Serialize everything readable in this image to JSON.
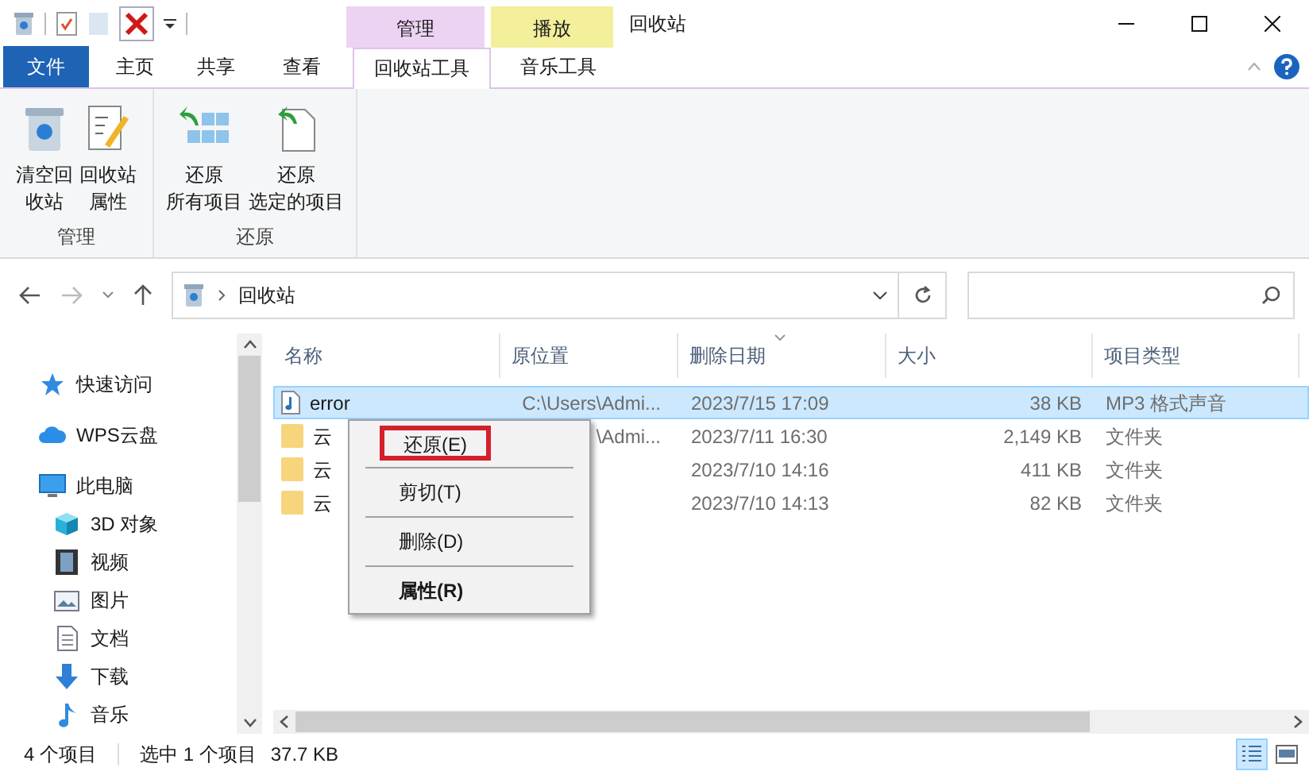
{
  "window": {
    "title": "回收站"
  },
  "context_tab_headers": [
    {
      "label": "管理",
      "color": "#ecd3f3"
    },
    {
      "label": "播放",
      "color": "#f3ef9b"
    }
  ],
  "ribbon_tabs": [
    {
      "label": "文件",
      "kind": "file",
      "selected": false
    },
    {
      "label": "主页",
      "kind": "tab",
      "selected": false
    },
    {
      "label": "共享",
      "kind": "tab",
      "selected": false
    },
    {
      "label": "查看",
      "kind": "tab",
      "selected": false
    },
    {
      "label": "回收站工具",
      "kind": "tab",
      "selected": true
    },
    {
      "label": "音乐工具",
      "kind": "tab",
      "selected": false
    }
  ],
  "ribbon_groups": [
    {
      "label": "管理",
      "buttons": [
        {
          "kind": "bin",
          "lines": [
            "清空回",
            "收站"
          ]
        },
        {
          "kind": "properties",
          "lines": [
            "回收站",
            "属性"
          ]
        }
      ]
    },
    {
      "label": "还原",
      "buttons": [
        {
          "kind": "restore_all",
          "lines": [
            "还原",
            "所有项目"
          ]
        },
        {
          "kind": "restore_selected",
          "lines": [
            "还原",
            "选定的项目"
          ]
        }
      ]
    }
  ],
  "address_bar": {
    "path": "回收站"
  },
  "sidebar": {
    "items": [
      {
        "label": "快速访问",
        "kind": "star"
      },
      {
        "label": "WPS云盘",
        "kind": "cloud"
      },
      {
        "label": "此电脑",
        "kind": "pc",
        "children": [
          {
            "label": "3D 对象",
            "kind": "cube"
          },
          {
            "label": "视频",
            "kind": "video"
          },
          {
            "label": "图片",
            "kind": "image"
          },
          {
            "label": "文档",
            "kind": "doc"
          },
          {
            "label": "下载",
            "kind": "download"
          },
          {
            "label": "音乐",
            "kind": "music"
          }
        ]
      }
    ]
  },
  "table": {
    "columns": [
      {
        "label": "名称",
        "sorted": false
      },
      {
        "label": "原位置",
        "sorted": false
      },
      {
        "label": "删除日期",
        "sorted": true
      },
      {
        "label": "大小",
        "sorted": false
      },
      {
        "label": "项目类型",
        "sorted": false
      }
    ],
    "rows": [
      {
        "kind": "audio",
        "name": "error",
        "location": "C:\\Users\\Admi...",
        "date": "2023/7/15 17:09",
        "size": "38 KB",
        "type": "MP3 格式声音",
        "selected": true
      },
      {
        "kind": "folder",
        "name": "云",
        "location": "\\Admi...",
        "date": "2023/7/11 16:30",
        "size": "2,149 KB",
        "type": "文件夹",
        "selected": false
      },
      {
        "kind": "folder",
        "name": "云",
        "date": "2023/7/10 14:16",
        "size": "411 KB",
        "type": "文件夹",
        "selected": false
      },
      {
        "kind": "folder",
        "name": "云",
        "date": "2023/7/10 14:13",
        "size": "82 KB",
        "type": "文件夹",
        "selected": false
      }
    ]
  },
  "context_menu": {
    "items": [
      {
        "label": "还原(E)",
        "outlined": true,
        "bold": false
      },
      {
        "label": "剪切(T)",
        "outlined": false,
        "bold": false
      },
      {
        "label": "删除(D)",
        "outlined": false,
        "bold": false
      },
      {
        "label": "属性(R)",
        "outlined": false,
        "bold": true
      }
    ]
  },
  "status_bar": {
    "count": "4 个项目",
    "selection": "选中 1 个项目",
    "size": "37.7 KB"
  },
  "view_buttons": [
    {
      "kind": "details",
      "selected": true
    },
    {
      "kind": "tiles",
      "selected": false
    }
  ]
}
